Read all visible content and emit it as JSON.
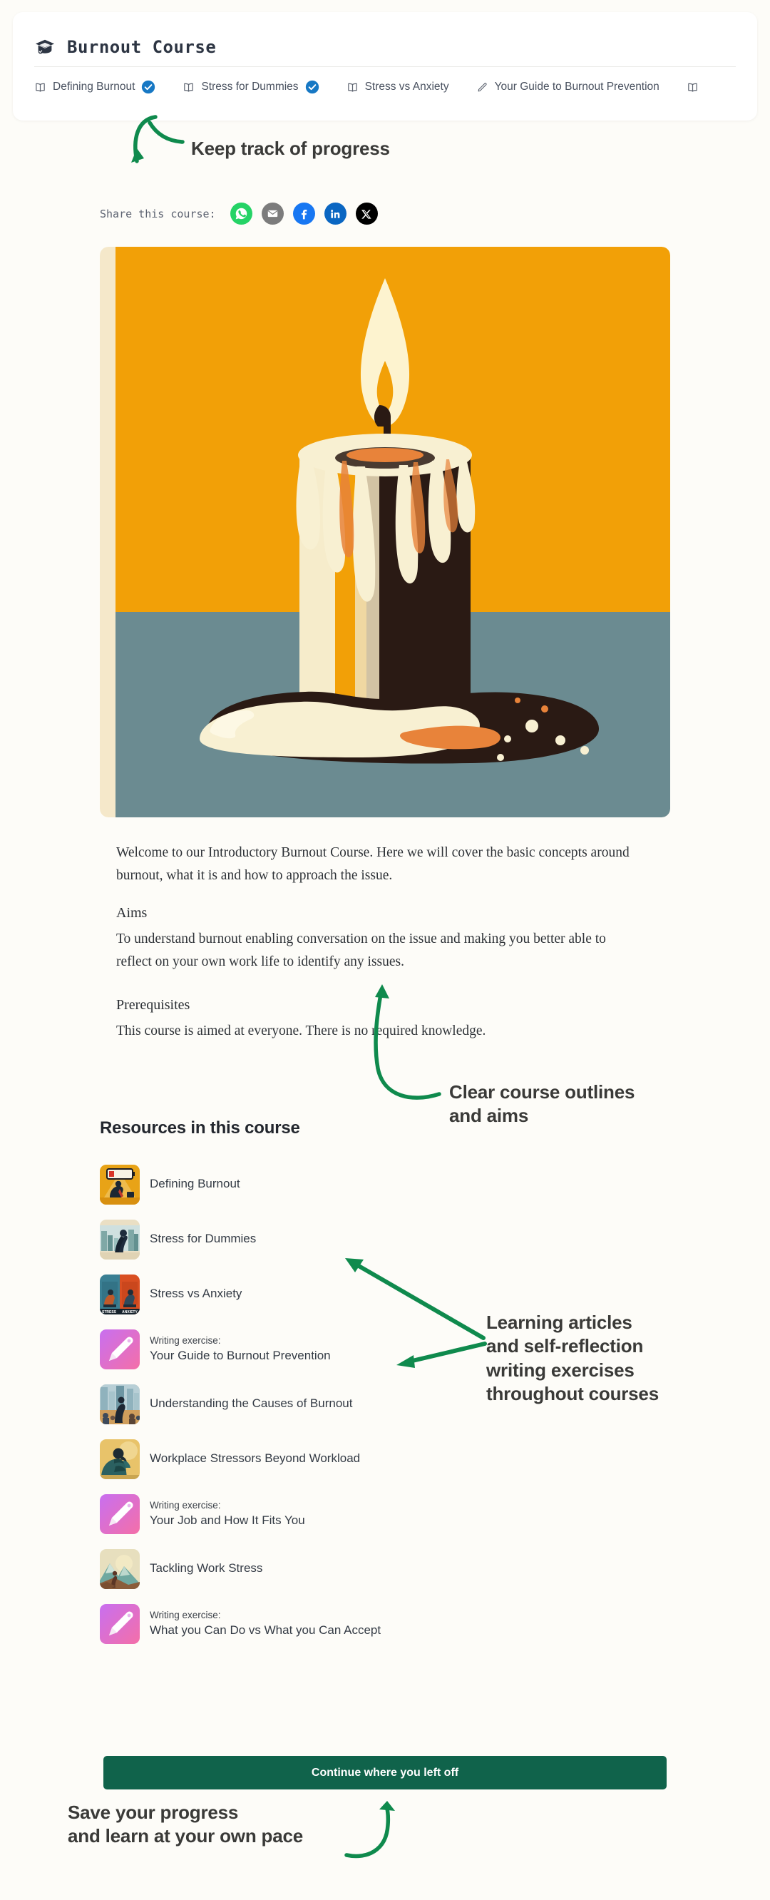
{
  "page": {
    "background_color": "#fdfcf8",
    "accent_green": "#0f8a4d",
    "button_green": "#10634b"
  },
  "header": {
    "logo_icon": "graduation-cap-icon",
    "title": "Burnout Course",
    "tabs": [
      {
        "icon": "book-icon",
        "label": "Defining Burnout",
        "completed": true
      },
      {
        "icon": "book-icon",
        "label": "Stress for Dummies",
        "completed": true
      },
      {
        "icon": "book-icon",
        "label": "Stress vs Anxiety",
        "completed": false
      },
      {
        "icon": "pencil-icon",
        "label": "Your Guide to Burnout Prevention",
        "completed": false
      },
      {
        "icon": "book-icon",
        "label": "",
        "completed": false
      }
    ]
  },
  "annotations": [
    {
      "id": "progress",
      "text": "Keep track of progress"
    },
    {
      "id": "outlines",
      "line1": "Clear course outlines",
      "line2": "and aims"
    },
    {
      "id": "articles",
      "line1": "Learning articles",
      "line2": "and self-reflection",
      "line3": "writing exercises",
      "line4": "throughout courses"
    },
    {
      "id": "save",
      "line1": "Save your progress",
      "line2": "and learn at your own pace"
    }
  ],
  "share": {
    "label": "Share this course:",
    "buttons": [
      {
        "name": "whatsapp-share-button",
        "icon": "whatsapp-icon",
        "color": "#25d366"
      },
      {
        "name": "email-share-button",
        "icon": "envelope-icon",
        "color": "#7c7c7c"
      },
      {
        "name": "facebook-share-button",
        "icon": "facebook-icon",
        "color": "#1877f2"
      },
      {
        "name": "linkedin-share-button",
        "icon": "linkedin-icon",
        "color": "#0a66c2"
      },
      {
        "name": "x-share-button",
        "icon": "x-twitter-icon",
        "color": "#000000"
      }
    ]
  },
  "hero": {
    "alt": "Retro illustration of a melting lit candle",
    "background_top": "#f2a007",
    "background_bottom": "#6b8b91",
    "frame_color": "#f5e6c8"
  },
  "body": {
    "intro": "Welcome to our Introductory Burnout Course. Here we will cover the basic concepts around burnout, what it is and how to approach the issue.",
    "aims_heading": "Aims",
    "aims_text": "To understand burnout enabling conversation on the issue and making you better able to reflect on your own work life to identify any issues.",
    "prereq_heading": "Prerequisites",
    "prereq_text": "This course is aimed at everyone. There is no required knowledge."
  },
  "resources": {
    "heading": "Resources in this course",
    "items": [
      {
        "thumb": "burnout-battery-thumb",
        "kicker": "",
        "name": "Defining Burnout"
      },
      {
        "thumb": "city-silhouette-thumb",
        "kicker": "",
        "name": "Stress for Dummies"
      },
      {
        "thumb": "stress-anxiety-split-thumb",
        "kicker": "",
        "name": "Stress vs Anxiety"
      },
      {
        "thumb": "pencil-thumb",
        "kicker": "Writing exercise:",
        "name": "Your Guide to Burnout Prevention"
      },
      {
        "thumb": "city-crowd-thumb",
        "kicker": "",
        "name": "Understanding the Causes of Burnout"
      },
      {
        "thumb": "tired-worker-thumb",
        "kicker": "",
        "name": "Workplace Stressors Beyond Workload"
      },
      {
        "thumb": "pencil-thumb",
        "kicker": "Writing exercise:",
        "name": "Your Job and How It Fits You"
      },
      {
        "thumb": "mountain-hiker-thumb",
        "kicker": "",
        "name": "Tackling Work Stress"
      },
      {
        "thumb": "pencil-thumb",
        "kicker": "Writing exercise:",
        "name": "What you Can Do vs What you Can Accept"
      }
    ]
  },
  "footer": {
    "continue_label": "Continue where you left off"
  }
}
